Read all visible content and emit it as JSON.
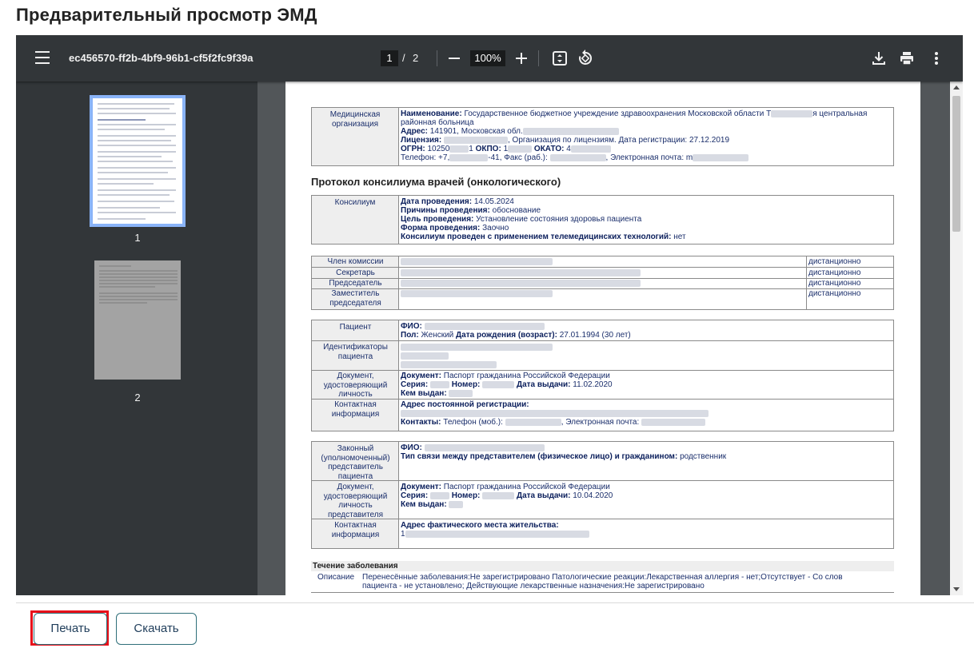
{
  "dialog": {
    "title": "Предварительный просмотр ЭМД",
    "print_label": "Печать",
    "download_label": "Скачать"
  },
  "viewer": {
    "filename": "ec456570-ff2b-4bf9-96b1-cf5f2fc9f39a",
    "current_page": "1",
    "page_separator": "/",
    "total_pages": "2",
    "zoom": "100%",
    "thumbnails": [
      {
        "label": "1",
        "active": true
      },
      {
        "label": "2",
        "active": false
      }
    ],
    "icons": [
      "menu-icon",
      "zoom-out-icon",
      "zoom-in-icon",
      "fit-page-icon",
      "rotate-icon",
      "download-icon",
      "print-icon",
      "more-icon"
    ],
    "colors": {
      "toolbar": "#323639",
      "background": "#525659",
      "active_thumb": "#8ab4f8"
    }
  },
  "document": {
    "org": {
      "label": "Медицинская организация",
      "name_key": "Наименование:",
      "name_val_a": "Государственное бюджетное учреждение здравоохранения Московской области Т",
      "name_val_b": "я центральная",
      "name_val_c": "районная больница",
      "address_key": "Адрес:",
      "address_val": "141901, Московская обл.",
      "license_key": "Лицензия:",
      "license_val": ", Организация по лицензиям. Дата регистрации: 27.12.2019",
      "ogrn_key": "ОГРН:",
      "ogrn_val": "10250",
      "ogrn_tail": "1",
      "okpo_key": "ОКПО:",
      "okpo_val": "1",
      "okato_key": "ОКАТО:",
      "okato_val": "4",
      "phone_val_a": "Телефон: +7,",
      "phone_val_b": "-41, Факс (раб.): ",
      "phone_val_c": ", Электронная почта: m"
    },
    "protocol_title": "Протокол консилиума врачей (онкологического)",
    "consilium": {
      "label": "Консилиум",
      "date_key": "Дата проведения:",
      "date_val": "14.05.2024",
      "reason_key": "Причины проведения:",
      "reason_val": "обоснование",
      "goal_key": "Цель проведения:",
      "goal_val": "Установление состояния здоровья пациента",
      "form_key": "Форма проведения:",
      "form_val": "Заочно",
      "telemed_key": "Консилиум проведен с применением телемедицинских технологий:",
      "telemed_val": "нет"
    },
    "commission": [
      {
        "role": "Член комиссии",
        "mode": "дистанционно"
      },
      {
        "role": "Секретарь",
        "mode": "дистанционно"
      },
      {
        "role": "Председатель",
        "mode": "дистанционно"
      },
      {
        "role": "Заместитель председателя",
        "mode": "дистанционно"
      }
    ],
    "patient": {
      "label": "Пациент",
      "fio_key": "ФИО:",
      "sex_key": "Пол:",
      "sex_val": "Женский",
      "dob_key": "Дата рождения (возраст):",
      "dob_val": "27.01.1994 (30 лет)",
      "ids_label": "Идентификаторы пациента",
      "doc_label": "Документ, удостоверяющий личность",
      "doc_key": "Документ:",
      "doc_val": "Паспорт гражданина Российской Федерации",
      "series_key": "Серия:",
      "number_key": "Номер:",
      "issue_date_key": "Дата выдачи:",
      "issue_date_val": "11.02.2020",
      "issued_by_key": "Кем выдан:",
      "contact_label": "Контактная информация",
      "reg_address_key": "Адрес постоянной регистрации:",
      "contacts_key": "Контакты:",
      "contacts_val_a": "Телефон (моб.):",
      "contacts_val_b": ", Электронная почта:"
    },
    "representative": {
      "label": "Законный (уполномоченный) представитель пациента",
      "fio_key": "ФИО:",
      "relation_key": "Тип связи между представителем (физическое лицо) и гражданином:",
      "relation_val": "родственник",
      "doc_label": "Документ, удостоверяющий личность представителя",
      "doc_key": "Документ:",
      "doc_val": "Паспорт гражданина Российской Федерации",
      "series_key": "Серия:",
      "number_key": "Номер:",
      "issue_date_key": "Дата выдачи:",
      "issue_date_val": "10.04.2020",
      "issued_by_key": "Кем выдан:",
      "contact_label": "Контактная информация",
      "addr_key": "Адрес фактического места жительства:",
      "addr_val": "1"
    },
    "disease": {
      "header": "Течение заболевания",
      "desc_label": "Описание",
      "desc_line1": "Перенесённые заболевания:Не зарегистрировано Патологические реакции:Лекарственная аллергия - нет;Отсутствует - Со слов",
      "desc_line2": "пациента - не установлено; Действующие лекарственные назначения:Не зарегистрировано"
    }
  }
}
